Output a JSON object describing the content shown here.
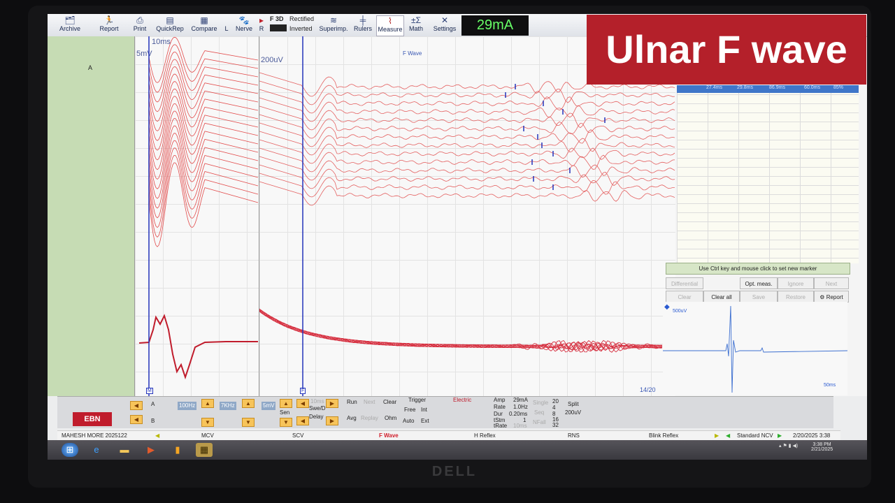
{
  "toolbar": {
    "archive": "Archive",
    "report": "Report",
    "print": "Print",
    "quickrep": "QuickRep",
    "compare": "Compare",
    "l": "L",
    "nerve": "Nerve",
    "r": "R",
    "f3d": "F 3D",
    "rectified": "Rectified",
    "inverted": "Inverted",
    "superimp": "Superimp.",
    "rulers": "Rulers",
    "measure": "Measure",
    "math": "Math",
    "settings": "Settings",
    "current": "29mA"
  },
  "traces": {
    "left_marker": "A",
    "time_label": "10ms",
    "sens_label": "5mV",
    "sens2_label": "200uV",
    "wave_title": "F Wave",
    "counter": "14/20",
    "m_marker": "M",
    "f_marker": "F"
  },
  "results_table": {
    "headers": [
      "27.4ms",
      "29.8ms",
      "86.9ms",
      "60.0ms",
      "85%"
    ]
  },
  "measure_panel": {
    "hint": "Use Ctrl key and mouse click to set new marker",
    "differential": "Differential",
    "opt_meas": "Opt. meas.",
    "ignore": "Ignore",
    "next": "Next",
    "clear": "Clear",
    "clear_all": "Clear all",
    "save": "Save",
    "restore": "Restore",
    "report": "Report",
    "mini_sens": "500uV",
    "mini_time": "50ms"
  },
  "controls": {
    "logo": "EBN",
    "a": "A",
    "b": "B",
    "lowfilter": "100Hz",
    "highfilter": "7KHz",
    "sens": "5mV",
    "sen_label": "Sen",
    "sweep": "10ms",
    "swe_d": "Swe/D",
    "delay": "Delay",
    "run": "Run",
    "next": "Next",
    "replay": "Replay",
    "avg": "Avg",
    "clear": "Clear",
    "ohm": "Ohm",
    "trigger": "Trigger",
    "free": "Free",
    "int": "Int",
    "auto": "Auto",
    "ext": "Ext",
    "electric": "Electric",
    "amp_label": "Amp",
    "amp_value": "29mA",
    "rate_label": "Rate",
    "rate_value": "1.0Hz",
    "dur_label": "Dur",
    "dur_value": "0.20ms",
    "tstm_label": "tStm",
    "tstm_value": "1",
    "trate_label": "tRate",
    "trate_value": "10ms",
    "single": "Single",
    "seq": "Seq",
    "nfall": "NFall",
    "num1": "20",
    "num2": "4",
    "num3": "8",
    "num4": "16",
    "num5": "32",
    "split": "Split",
    "split_val": "200uV"
  },
  "statusbar": {
    "patient": "MAHESH MORE 2025122",
    "mcv": "MCV",
    "scv": "SCV",
    "fwave": "F Wave",
    "hreflex": "H Reflex",
    "rns": "RNS",
    "blink": "Blink Reflex",
    "protocol": "Standard NCV",
    "datetime": "2/20/2025 3:38"
  },
  "taskbar": {
    "time": "3:38 PM",
    "date": "2/21/2025"
  },
  "overlay": {
    "title": "Ulnar F wave"
  },
  "monitor": {
    "brand": "DELL"
  }
}
